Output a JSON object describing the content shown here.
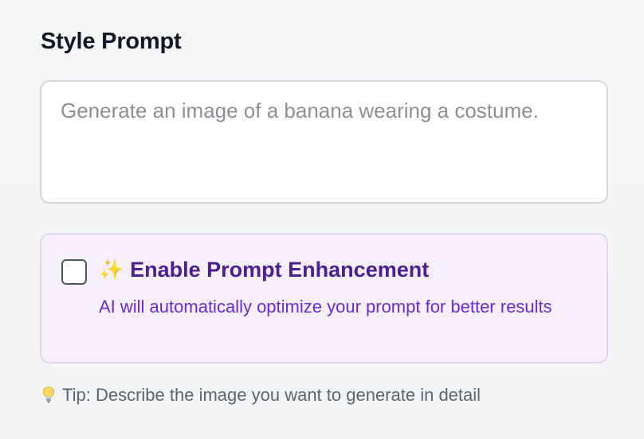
{
  "style_prompt": {
    "title": "Style Prompt",
    "placeholder": "Generate an image of a banana wearing a costume.",
    "value": ""
  },
  "enhancement": {
    "icon": "sparkles-icon",
    "icon_glyph": "✨",
    "label": "Enable Prompt Enhancement",
    "description": "AI will automatically optimize your prompt for better results",
    "checked": false
  },
  "tip": {
    "icon": "lightbulb-icon",
    "text": "Tip: Describe the image you want to generate in detail"
  },
  "colors": {
    "enhance_background": "#f5f0fc",
    "enhance_border": "#e4d4f7",
    "enhance_label": "#4c1d95",
    "enhance_description": "#6d28d9"
  }
}
